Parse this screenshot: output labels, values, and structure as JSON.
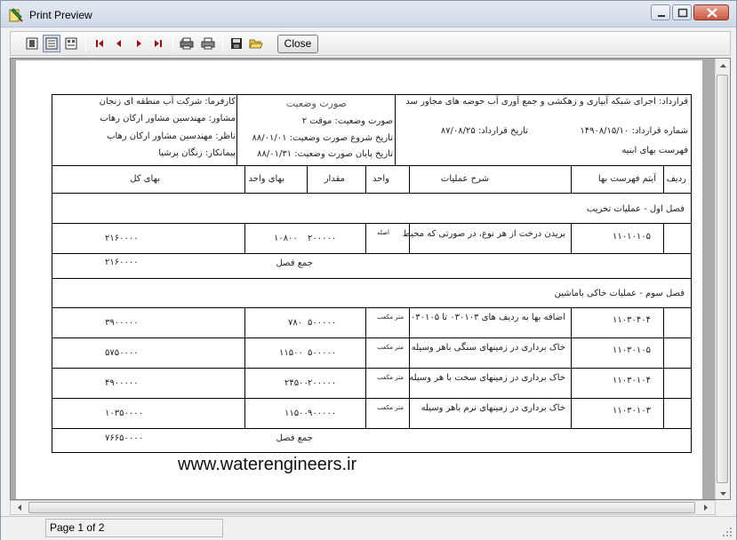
{
  "window": {
    "title": "Print Preview"
  },
  "toolbar": {
    "close_label": "Close"
  },
  "status": {
    "page": "Page 1 of 2"
  },
  "report": {
    "header": {
      "employer": "کارفرما: شرکت آب منطقه ای زنجان",
      "consultant": "مشاور: مهندسین مشاور ارکان رهاب",
      "supervisor": "ناظر: مهندسین مشاور ارکان رهاب",
      "contractor": "پیمانکار: زنگان پرشیا",
      "doc_title": "صورت وضعیت",
      "status_type": "صورت وضعیت: موقت ۲",
      "start_date": "تاریخ شروع صورت وضعیت: ۸۸/۰۱/۰۱",
      "end_date": "تاریخ پایان صورت وضعیت: ۸۸/۰۱/۳۱",
      "contract": "قرارداد: اجرای شبکه آبیاری و زهکشی و جمع آوری آب حوضه های مجاور سد",
      "contract_no": "شماره قرارداد: ۱۴۹۰۸/۱۵/۱۰",
      "contract_date": "تاریخ قرارداد: ۸۷/۰۸/۲۵",
      "price_list": "فهرست بهای ابنیه"
    },
    "columns": {
      "row": "ردیف",
      "item": "آیتم فهرست بها",
      "description": "شرح عملیات",
      "unit": "واحد",
      "qty": "مقدار",
      "unit_price": "بهای واحد",
      "total": "بهای کل"
    },
    "sections": [
      {
        "title": "فصل اول - عملیات تخریب",
        "rows": [
          {
            "item": "۱۱۰۱۰۱۰۵",
            "desc": "بریدن درخت از هر نوع، در صورتی که محیط",
            "unit": "اصله",
            "qty": "۲۰۰۰۰۰",
            "unit_price": "۱۰۸۰۰",
            "total": "۲۱۶۰۰۰۰"
          }
        ],
        "sum_label": "جمع فصل",
        "sum_value": "۲۱۶۰۰۰۰"
      },
      {
        "title": "فصل سوم - عملیات خاکی باماشین",
        "rows": [
          {
            "item": "۱۱۰۳۰۴۰۴",
            "desc": "اضافه بها به ردیف های ۰۳۰۱۰۳ تا ۰۳۰۱۰۵",
            "unit": "متر مکعب",
            "qty": "۵۰۰۰۰۰",
            "unit_price": "۷۸۰",
            "total": "۳۹۰۰۰۰۰"
          },
          {
            "item": "۱۱۰۳۰۱۰۵",
            "desc": "خاک برداری در زمینهای سنگی باهر وسیله",
            "unit": "متر مکعب",
            "qty": "۵۰۰۰۰۰",
            "unit_price": "۱۱۵۰۰",
            "total": "۵۷۵۰۰۰۰"
          },
          {
            "item": "۱۱۰۳۰۱۰۴",
            "desc": "خاک برداری در زمینهای سخت با هر وسیله",
            "unit": "متر مکعب",
            "qty": "۲۰۰۰۰۰",
            "unit_price": "۲۴۵۰۰",
            "total": "۴۹۰۰۰۰۰"
          },
          {
            "item": "۱۱۰۳۰۱۰۳",
            "desc": "خاک برداری در زمینهای نرم باهر وسیله",
            "unit": "متر مکعب",
            "qty": "۹۰۰۰۰۰",
            "unit_price": "۱۱۵۰۰",
            "total": "۱۰۳۵۰۰۰۰"
          }
        ],
        "sum_label": "جمع فصل",
        "sum_value": "۷۶۶۵۰۰۰۰"
      }
    ],
    "watermark": "www.waterengineers.ir"
  }
}
